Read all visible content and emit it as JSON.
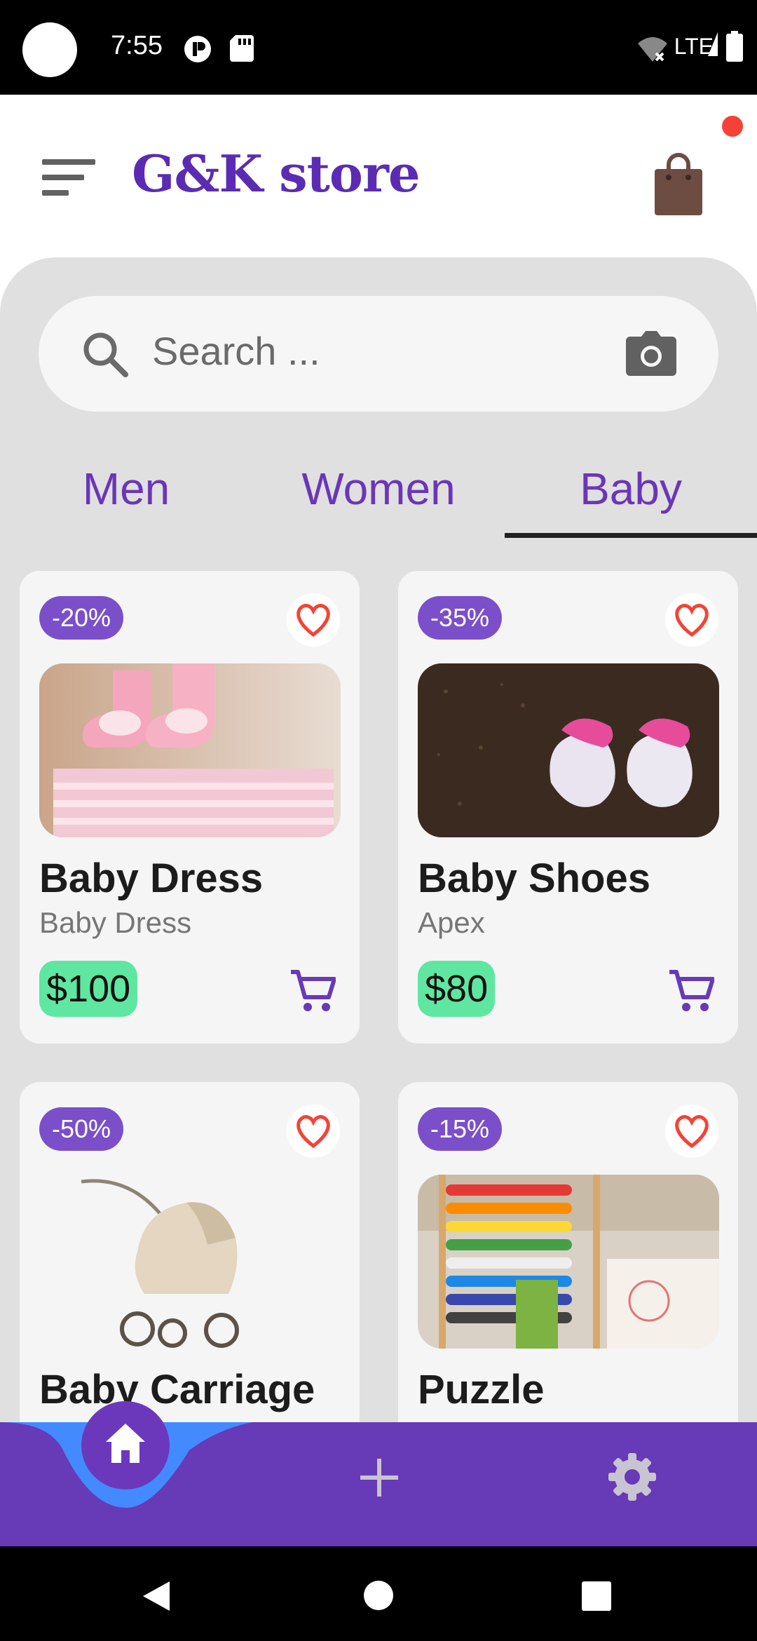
{
  "status_bar": {
    "time": "7:55",
    "network": "LTE"
  },
  "header": {
    "title": "G&K store"
  },
  "search": {
    "placeholder": "Search ..."
  },
  "tabs": [
    {
      "label": "Men"
    },
    {
      "label": "Women"
    },
    {
      "label": "Baby",
      "selected": true
    }
  ],
  "products": [
    {
      "title": "Baby Dress",
      "subtitle": "Baby Dress",
      "price": "$100",
      "discount": "-20%"
    },
    {
      "title": "Baby Shoes",
      "subtitle": "Apex",
      "price": "$80",
      "discount": "-35%"
    },
    {
      "title": "Baby Carriage",
      "subtitle": "",
      "price": "",
      "discount": "-50%"
    },
    {
      "title": "Puzzle",
      "subtitle": "",
      "price": "",
      "discount": "-15%"
    }
  ],
  "bottom_nav": {
    "items": [
      "home-icon",
      "plus-icon",
      "gear-icon"
    ],
    "active": "home-icon"
  },
  "colors": {
    "brand": "#5b2cb3",
    "badge": "#7b4fc9",
    "price_bg": "#5fe6a0",
    "nav_bg": "#673ab7",
    "nav_highlight": "#448aff",
    "heart": "#f44336"
  }
}
